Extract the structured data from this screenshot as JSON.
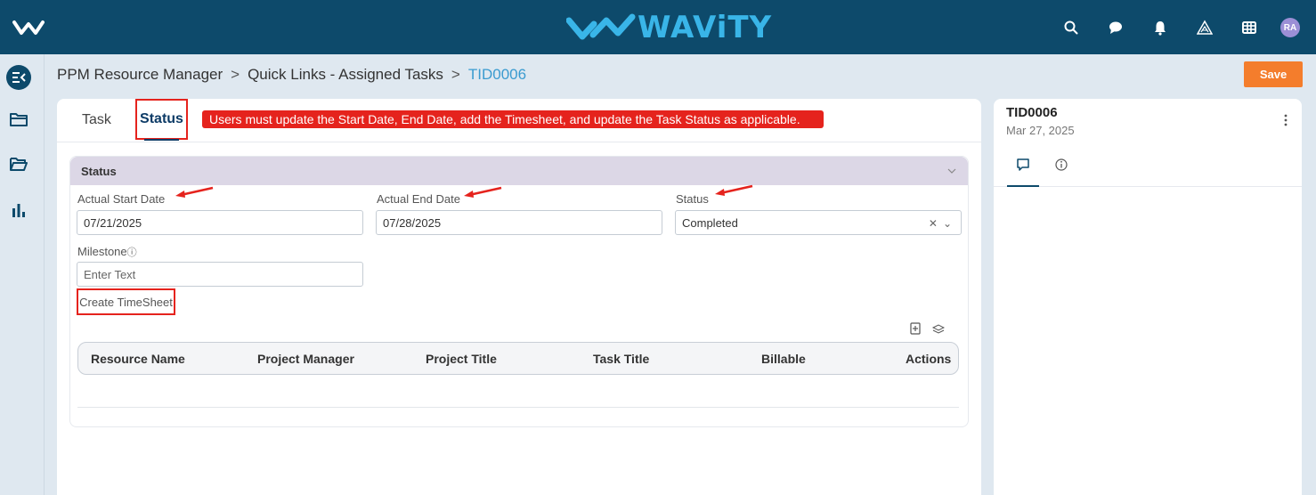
{
  "header": {
    "brand": "WAViTY",
    "avatar_initials": "RA",
    "icons": [
      "search-icon",
      "chat-icon",
      "bell-icon",
      "triangle-logo-icon",
      "grid-icon"
    ]
  },
  "rail": {
    "items": [
      "collapse-menu-icon",
      "folder-icon",
      "folder-open-icon",
      "bar-chart-icon"
    ]
  },
  "breadcrumb": {
    "items": [
      "PPM Resource Manager",
      "Quick Links - Assigned Tasks"
    ],
    "separator": ">",
    "current": "TID0006"
  },
  "toolbar": {
    "save_label": "Save"
  },
  "tabs": {
    "task": "Task",
    "status": "Status"
  },
  "notice": "Users must update the Start Date, End Date, add the Timesheet, and update the Task Status as applicable.",
  "section": {
    "title": "Status",
    "fields": {
      "actual_start_label": "Actual Start Date",
      "actual_start_value": "07/21/2025",
      "actual_end_label": "Actual End Date",
      "actual_end_value": "07/28/2025",
      "status_label": "Status",
      "status_value": "Completed",
      "milestone_label": "Milestone",
      "milestone_placeholder": "Enter Text"
    },
    "timesheet_link": "Create TimeSheet",
    "table": {
      "columns": [
        "Resource Name",
        "Project Manager",
        "Project Title",
        "Task Title",
        "Billable",
        "Actions"
      ],
      "rows": []
    }
  },
  "side_panel": {
    "title": "TID0006",
    "date": "Mar 27, 2025",
    "tabs": [
      "comment-icon",
      "info-icon"
    ]
  },
  "colors": {
    "header_bg": "#0d4a6b",
    "brand": "#39b5e8",
    "save": "#f47d2c",
    "annotation_red": "#e5231d",
    "link_blue": "#3a9bd0"
  }
}
